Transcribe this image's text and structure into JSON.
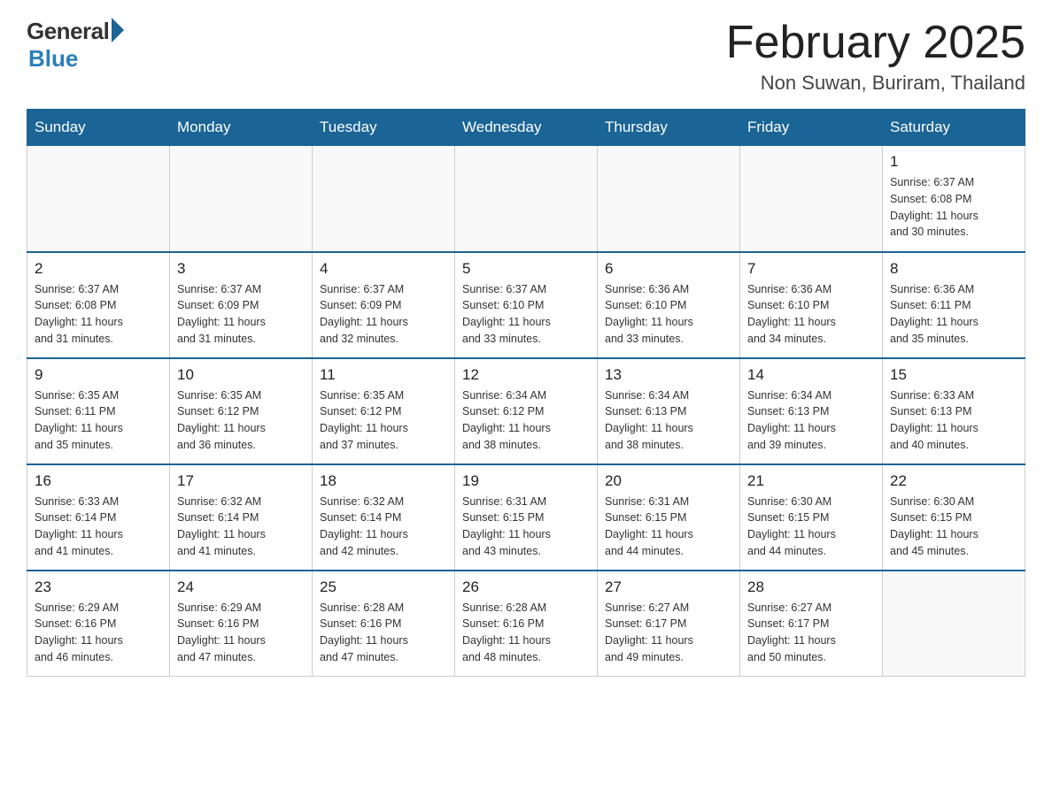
{
  "header": {
    "logo": {
      "general": "General",
      "blue": "Blue"
    },
    "title": "February 2025",
    "location": "Non Suwan, Buriram, Thailand"
  },
  "weekdays": [
    "Sunday",
    "Monday",
    "Tuesday",
    "Wednesday",
    "Thursday",
    "Friday",
    "Saturday"
  ],
  "weeks": [
    [
      {
        "day": "",
        "info": ""
      },
      {
        "day": "",
        "info": ""
      },
      {
        "day": "",
        "info": ""
      },
      {
        "day": "",
        "info": ""
      },
      {
        "day": "",
        "info": ""
      },
      {
        "day": "",
        "info": ""
      },
      {
        "day": "1",
        "info": "Sunrise: 6:37 AM\nSunset: 6:08 PM\nDaylight: 11 hours\nand 30 minutes."
      }
    ],
    [
      {
        "day": "2",
        "info": "Sunrise: 6:37 AM\nSunset: 6:08 PM\nDaylight: 11 hours\nand 31 minutes."
      },
      {
        "day": "3",
        "info": "Sunrise: 6:37 AM\nSunset: 6:09 PM\nDaylight: 11 hours\nand 31 minutes."
      },
      {
        "day": "4",
        "info": "Sunrise: 6:37 AM\nSunset: 6:09 PM\nDaylight: 11 hours\nand 32 minutes."
      },
      {
        "day": "5",
        "info": "Sunrise: 6:37 AM\nSunset: 6:10 PM\nDaylight: 11 hours\nand 33 minutes."
      },
      {
        "day": "6",
        "info": "Sunrise: 6:36 AM\nSunset: 6:10 PM\nDaylight: 11 hours\nand 33 minutes."
      },
      {
        "day": "7",
        "info": "Sunrise: 6:36 AM\nSunset: 6:10 PM\nDaylight: 11 hours\nand 34 minutes."
      },
      {
        "day": "8",
        "info": "Sunrise: 6:36 AM\nSunset: 6:11 PM\nDaylight: 11 hours\nand 35 minutes."
      }
    ],
    [
      {
        "day": "9",
        "info": "Sunrise: 6:35 AM\nSunset: 6:11 PM\nDaylight: 11 hours\nand 35 minutes."
      },
      {
        "day": "10",
        "info": "Sunrise: 6:35 AM\nSunset: 6:12 PM\nDaylight: 11 hours\nand 36 minutes."
      },
      {
        "day": "11",
        "info": "Sunrise: 6:35 AM\nSunset: 6:12 PM\nDaylight: 11 hours\nand 37 minutes."
      },
      {
        "day": "12",
        "info": "Sunrise: 6:34 AM\nSunset: 6:12 PM\nDaylight: 11 hours\nand 38 minutes."
      },
      {
        "day": "13",
        "info": "Sunrise: 6:34 AM\nSunset: 6:13 PM\nDaylight: 11 hours\nand 38 minutes."
      },
      {
        "day": "14",
        "info": "Sunrise: 6:34 AM\nSunset: 6:13 PM\nDaylight: 11 hours\nand 39 minutes."
      },
      {
        "day": "15",
        "info": "Sunrise: 6:33 AM\nSunset: 6:13 PM\nDaylight: 11 hours\nand 40 minutes."
      }
    ],
    [
      {
        "day": "16",
        "info": "Sunrise: 6:33 AM\nSunset: 6:14 PM\nDaylight: 11 hours\nand 41 minutes."
      },
      {
        "day": "17",
        "info": "Sunrise: 6:32 AM\nSunset: 6:14 PM\nDaylight: 11 hours\nand 41 minutes."
      },
      {
        "day": "18",
        "info": "Sunrise: 6:32 AM\nSunset: 6:14 PM\nDaylight: 11 hours\nand 42 minutes."
      },
      {
        "day": "19",
        "info": "Sunrise: 6:31 AM\nSunset: 6:15 PM\nDaylight: 11 hours\nand 43 minutes."
      },
      {
        "day": "20",
        "info": "Sunrise: 6:31 AM\nSunset: 6:15 PM\nDaylight: 11 hours\nand 44 minutes."
      },
      {
        "day": "21",
        "info": "Sunrise: 6:30 AM\nSunset: 6:15 PM\nDaylight: 11 hours\nand 44 minutes."
      },
      {
        "day": "22",
        "info": "Sunrise: 6:30 AM\nSunset: 6:15 PM\nDaylight: 11 hours\nand 45 minutes."
      }
    ],
    [
      {
        "day": "23",
        "info": "Sunrise: 6:29 AM\nSunset: 6:16 PM\nDaylight: 11 hours\nand 46 minutes."
      },
      {
        "day": "24",
        "info": "Sunrise: 6:29 AM\nSunset: 6:16 PM\nDaylight: 11 hours\nand 47 minutes."
      },
      {
        "day": "25",
        "info": "Sunrise: 6:28 AM\nSunset: 6:16 PM\nDaylight: 11 hours\nand 47 minutes."
      },
      {
        "day": "26",
        "info": "Sunrise: 6:28 AM\nSunset: 6:16 PM\nDaylight: 11 hours\nand 48 minutes."
      },
      {
        "day": "27",
        "info": "Sunrise: 6:27 AM\nSunset: 6:17 PM\nDaylight: 11 hours\nand 49 minutes."
      },
      {
        "day": "28",
        "info": "Sunrise: 6:27 AM\nSunset: 6:17 PM\nDaylight: 11 hours\nand 50 minutes."
      },
      {
        "day": "",
        "info": ""
      }
    ]
  ]
}
